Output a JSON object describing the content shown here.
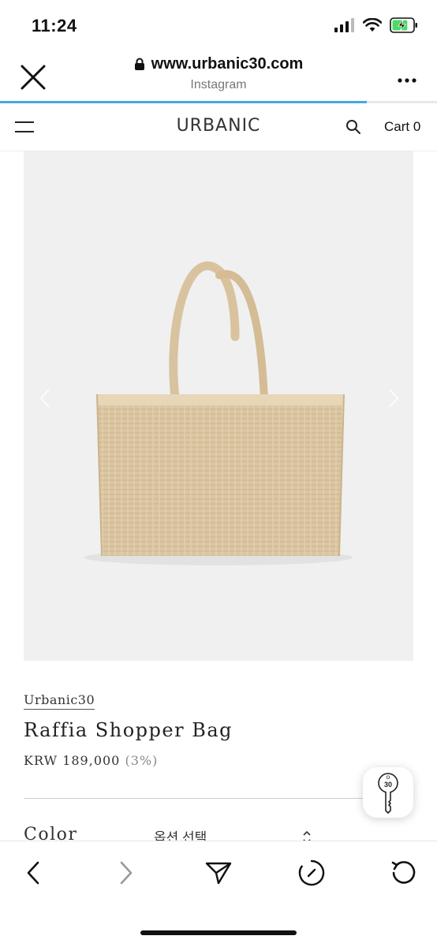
{
  "status_bar": {
    "time": "11:24",
    "battery_level": 0.75
  },
  "browser": {
    "url": "www.urbanic30.com",
    "subtitle": "Instagram",
    "load_progress": 0.84
  },
  "site_header": {
    "logo": "URBANIC",
    "cart_label": "Cart",
    "cart_count": "0"
  },
  "product": {
    "brand": "Urbanic30",
    "title": "Raffia Shopper Bag",
    "currency": "KRW",
    "price": "189,000",
    "discount": "(3%)"
  },
  "options": {
    "color_label": "Color",
    "select_placeholder": "옵션 선택"
  },
  "icons": {
    "close": "close-icon",
    "lock": "lock-icon",
    "more": "more-icon",
    "menu": "menu-icon",
    "search": "search-icon",
    "prev": "chevron-left-icon",
    "next": "chevron-right-icon",
    "share": "send-icon",
    "timer": "timer-icon",
    "reload": "reload-icon",
    "key": "key-icon"
  },
  "colors": {
    "accent": "#43a8e0",
    "image_bg": "#f0f0f0",
    "bag": "#dcc6a2"
  }
}
